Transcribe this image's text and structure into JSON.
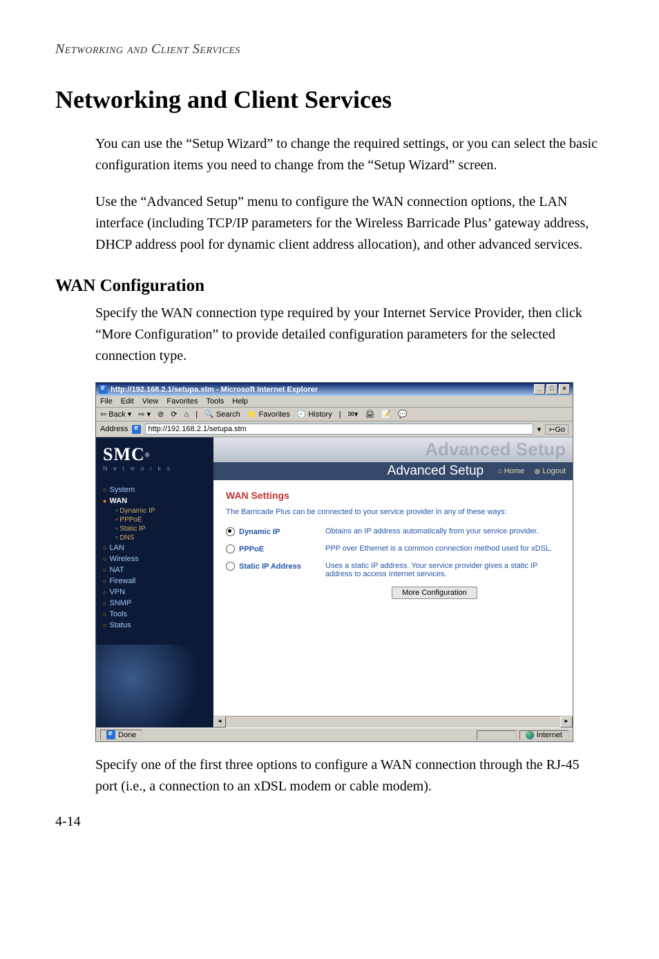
{
  "running_head": "Networking and Client Services",
  "title": "Networking and Client Services",
  "para1": "You can use the “Setup Wizard” to change the required settings, or you can select the basic configuration items you need to change from the “Setup Wizard” screen.",
  "para2": "Use the “Advanced Setup” menu to configure the WAN connection options, the LAN interface (including TCP/IP parameters for the Wireless Barricade Plus’ gateway address, DHCP address pool for dynamic client address allocation), and other advanced services.",
  "section_heading": "WAN Configuration",
  "para3": "Specify the WAN connection type required by your Internet Service Provider, then click “More Configuration” to provide detailed configuration parameters for the selected connection type.",
  "para4": "Specify one of the first three options to configure a WAN connection through the RJ-45 port (i.e., a connection to an xDSL modem or cable modem).",
  "page_number": "4-14",
  "browser": {
    "window_title": "http://192.168.2.1/setupa.stm - Microsoft Internet Explorer",
    "menus": [
      "File",
      "Edit",
      "View",
      "Favorites",
      "Tools",
      "Help"
    ],
    "toolbar": {
      "back": "Back",
      "search": "Search",
      "favorites": "Favorites",
      "history": "History"
    },
    "address_label": "Address",
    "address_value": "http://192.168.2.1/setupa.stm",
    "go_label": "Go",
    "status_left": "Done",
    "status_right": "Internet"
  },
  "app": {
    "logo": "SMC",
    "logo_reg": "®",
    "logo_sub": "N e t w o r k s",
    "banner_faded": "Advanced Setup",
    "banner_title": "Advanced Setup",
    "banner_home": "Home",
    "banner_logout": "Logout",
    "nav": {
      "items": [
        "System",
        "WAN",
        "LAN",
        "Wireless",
        "NAT",
        "Firewall",
        "VPN",
        "SNMP",
        "Tools",
        "Status"
      ],
      "wan_sub": [
        "Dynamic IP",
        "PPPoE",
        "Static IP",
        "DNS"
      ]
    },
    "panel": {
      "heading": "WAN Settings",
      "desc": "The Barricade Plus can be connected to your service provider in any of these ways:",
      "options": [
        {
          "label": "Dynamic IP",
          "desc": "Obtains an IP address automatically from your service provider.",
          "selected": true
        },
        {
          "label": "PPPoE",
          "desc": "PPP over Ethernet is a common connection method used for xDSL.",
          "selected": false
        },
        {
          "label": "Static IP Address",
          "desc": "Uses a static IP address. Your service provider gives a static IP address to access Internet services.",
          "selected": false
        }
      ],
      "more_button": "More Configuration"
    }
  }
}
